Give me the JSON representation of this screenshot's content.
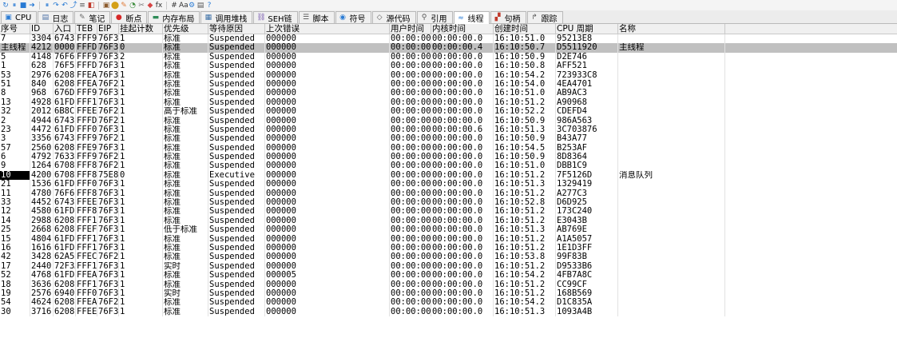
{
  "toolbar": {
    "icons": [
      "refresh-icon",
      "pause-icon",
      "stop-icon",
      "step-into-icon",
      "pause2-icon",
      "step-over-icon",
      "step-out-icon",
      "run-to-icon",
      "trace-icon",
      "animate-icon",
      "stack-icon",
      "memory-icon",
      "highlight-icon",
      "labels-icon",
      "comments-icon",
      "bookmark-icon",
      "function-icon",
      "hash-icon",
      "font-icon",
      "settings-icon",
      "layers-icon",
      "about-icon"
    ],
    "glyphs": [
      "↻",
      "⏸",
      "■",
      "➜",
      "⏸",
      "↷",
      "↶",
      "⤴",
      "≡",
      "◧",
      "▣",
      "⬤",
      "✎",
      "◔",
      "✂",
      "◆",
      "fx",
      "#",
      "Aa",
      "⚙",
      "▤",
      "?"
    ]
  },
  "tabs": [
    {
      "label": "CPU",
      "icon": "cpu-icon",
      "glyph": "▣",
      "active": false
    },
    {
      "label": "日志",
      "icon": "log-icon",
      "glyph": "▤",
      "active": false
    },
    {
      "label": "笔记",
      "icon": "notes-icon",
      "glyph": "✎",
      "active": false
    },
    {
      "label": "断点",
      "icon": "breakpoint-icon",
      "glyph": "●",
      "active": false
    },
    {
      "label": "内存布局",
      "icon": "memory-map-icon",
      "glyph": "▬",
      "active": false
    },
    {
      "label": "调用堆栈",
      "icon": "call-stack-icon",
      "glyph": "▦",
      "active": false
    },
    {
      "label": "SEH链",
      "icon": "seh-icon",
      "glyph": "⛓",
      "active": false
    },
    {
      "label": "脚本",
      "icon": "script-icon",
      "glyph": "☰",
      "active": false
    },
    {
      "label": "符号",
      "icon": "symbols-icon",
      "glyph": "◉",
      "active": false
    },
    {
      "label": "源代码",
      "icon": "source-icon",
      "glyph": "◇",
      "active": false
    },
    {
      "label": "引用",
      "icon": "references-icon",
      "glyph": "⚲",
      "active": false
    },
    {
      "label": "线程",
      "icon": "threads-icon",
      "glyph": "≈",
      "active": true
    },
    {
      "label": "句柄",
      "icon": "handles-icon",
      "glyph": "▞",
      "active": false
    },
    {
      "label": "跟踪",
      "icon": "trace-tab-icon",
      "glyph": "↱",
      "active": false
    }
  ],
  "columns": [
    "序号",
    "ID",
    "入口",
    "TEB",
    "EIP",
    "挂起计数",
    "优先级",
    "等待原因",
    "上次错误",
    "用户时间",
    "内核时间",
    "创建时间",
    "CPU 周期",
    "名称"
  ],
  "rows": [
    [
      "7",
      "3304",
      "67433:",
      "FFF93",
      "76F31",
      "1",
      "标准",
      "Suspended",
      "000000",
      "00:00:00.0",
      "00:00:00.0",
      "16:10:51.0",
      "95213E8",
      ""
    ],
    [
      "主线程",
      "4212",
      "000000",
      "FFFDD",
      "76F30:",
      "0",
      "标准",
      "Suspended",
      "000000",
      "00:00:00.4",
      "00:00:00.4",
      "16:10:50.7",
      "D5511920",
      "主线程"
    ],
    [
      "5",
      "4148",
      "76F604",
      "FFF99",
      "76F31",
      "2",
      "标准",
      "Suspended",
      "000000",
      "00:00:00.0",
      "00:00:00.0",
      "16:10:50.9",
      "D2E746",
      ""
    ],
    [
      "1",
      "628",
      "76F5F5",
      "FFFDA",
      "76F30:",
      "1",
      "标准",
      "Suspended",
      "000000",
      "00:00:00.0",
      "00:00:00.0",
      "16:10:50.8",
      "AFF521",
      ""
    ],
    [
      "53",
      "2976",
      "62089",
      "FFEA7",
      "76F30:",
      "1",
      "标准",
      "Suspended",
      "000000",
      "00:00:00.8",
      "00:00:00.0",
      "16:10:54.2",
      "723933C8",
      ""
    ],
    [
      "51",
      "840",
      "62089",
      "FFEAD",
      "76F2F",
      "1",
      "标准",
      "Suspended",
      "000000",
      "00:00:00.0",
      "00:00:00.0",
      "16:10:54.0",
      "4EA4701",
      ""
    ],
    [
      "8",
      "968",
      "676D6",
      "FFF90",
      "76F30:",
      "1",
      "标准",
      "Suspended",
      "000000",
      "00:00:00.0",
      "00:00:00.0",
      "16:10:51.0",
      "AB9AC3",
      ""
    ],
    [
      "13",
      "4928",
      "61FD2",
      "FFF1F",
      "76F30:",
      "1",
      "标准",
      "Suspended",
      "000000",
      "00:00:00.0",
      "00:00:00.0",
      "16:10:51.2",
      "A90968",
      ""
    ],
    [
      "32",
      "2012",
      "6B8C6",
      "FFEE3",
      "76F2F",
      "1",
      "高于标准",
      "Suspended",
      "000000",
      "00:00:00.0",
      "00:00:00.0",
      "16:10:52.2",
      "CDEFD4",
      ""
    ],
    [
      "2",
      "4944",
      "67433:",
      "FFFD7",
      "76F2F",
      "1",
      "标准",
      "Suspended",
      "000000",
      "00:00:00.0",
      "00:00:00.0",
      "16:10:50.9",
      "986A563",
      ""
    ],
    [
      "23",
      "4472",
      "61FD2",
      "FFF07",
      "76F30:",
      "1",
      "标准",
      "Suspended",
      "000000",
      "00:00:00.0",
      "00:00:00.6",
      "16:10:51.3",
      "3C703876",
      ""
    ],
    [
      "3",
      "3356",
      "67433:",
      "FFF9F",
      "76F2F",
      "1",
      "标准",
      "Suspended",
      "000000",
      "00:00:00.0",
      "00:00:00.0",
      "16:10:50.9",
      "B43A77",
      ""
    ],
    [
      "57",
      "2560",
      "62089",
      "FFE98",
      "76F30:",
      "1",
      "标准",
      "Suspended",
      "000000",
      "00:00:00.0",
      "00:00:00.0",
      "16:10:54.5",
      "B253AF",
      ""
    ],
    [
      "6",
      "4792",
      "7633D",
      "FFF96",
      "76F2F",
      "1",
      "标准",
      "Suspended",
      "000000",
      "00:00:00.0",
      "00:00:00.0",
      "16:10:50.9",
      "8D8364",
      ""
    ],
    [
      "9",
      "1264",
      "6708D",
      "FFF8D",
      "76F2F",
      "1",
      "标准",
      "Suspended",
      "000000",
      "00:00:00.0",
      "00:00:00.0",
      "16:10:51.0",
      "DBB1C9",
      ""
    ],
    [
      "10",
      "4200",
      "6708D",
      "FFF8A",
      "75E81",
      "0",
      "标准",
      "Executive",
      "000000",
      "00:00:00.0",
      "00:00:00.0",
      "16:10:51.2",
      "7F5126D",
      "消息队列"
    ],
    [
      "21",
      "1536",
      "61FD2",
      "FFF0D",
      "76F30:",
      "1",
      "标准",
      "Suspended",
      "000000",
      "00:00:00.0",
      "00:00:00.0",
      "16:10:51.3",
      "1329419",
      ""
    ],
    [
      "11",
      "4780",
      "76F604",
      "FFF87",
      "76F31",
      "1",
      "标准",
      "Suspended",
      "000000",
      "00:00:00.0",
      "00:00:00.0",
      "16:10:51.2",
      "A277C3",
      ""
    ],
    [
      "33",
      "4452",
      "67433:",
      "FFEE0",
      "76F31",
      "1",
      "标准",
      "Suspended",
      "000000",
      "00:00:00.0",
      "00:00:00.0",
      "16:10:52.8",
      "D6D925",
      ""
    ],
    [
      "12",
      "4580",
      "61FD2",
      "FFF84",
      "76F30:",
      "1",
      "标准",
      "Suspended",
      "000000",
      "00:00:00.0",
      "00:00:00.0",
      "16:10:51.2",
      "173C240",
      ""
    ],
    [
      "14",
      "2988",
      "62089",
      "FFF1C",
      "76F30:",
      "1",
      "标准",
      "Suspended",
      "000000",
      "00:00:00.0",
      "00:00:00.0",
      "16:10:51.2",
      "E3043B",
      ""
    ],
    [
      "25",
      "2668",
      "62089",
      "FFEFE",
      "76F30:",
      "1",
      "低于标准",
      "Suspended",
      "000000",
      "00:00:00.0",
      "00:00:00.0",
      "16:10:51.3",
      "AB769E",
      ""
    ],
    [
      "15",
      "4804",
      "61FD2",
      "FFF19",
      "76F30:",
      "1",
      "标准",
      "Suspended",
      "000000",
      "00:00:00.0",
      "00:00:00.0",
      "16:10:51.2",
      "A1A5057",
      ""
    ],
    [
      "16",
      "1616",
      "61FD2",
      "FFF16",
      "76F30:",
      "1",
      "标准",
      "Suspended",
      "000000",
      "00:00:00.0",
      "00:00:00.0",
      "16:10:51.2",
      "1E1D3FF",
      ""
    ],
    [
      "42",
      "3428",
      "62A5D",
      "FFEC8",
      "76F2F",
      "1",
      "标准",
      "Suspended",
      "000000",
      "00:00:00.0",
      "00:00:00.0",
      "16:10:53.8",
      "99F83B",
      ""
    ],
    [
      "17",
      "2440",
      "72F3A",
      "FFF13",
      "76F30:",
      "1",
      "实时",
      "Suspended",
      "000000",
      "00:00:00.0",
      "00:00:00.0",
      "16:10:51.2",
      "D9533B6",
      ""
    ],
    [
      "52",
      "4768",
      "61FD2",
      "FFEAA",
      "76F30:",
      "1",
      "标准",
      "Suspended",
      "000005",
      "00:00:00.0",
      "00:00:00.0",
      "16:10:54.2",
      "4FB7A8C",
      ""
    ],
    [
      "18",
      "3636",
      "62089",
      "FFF10",
      "76F30:",
      "1",
      "标准",
      "Suspended",
      "000000",
      "00:00:00.0",
      "00:00:00.0",
      "16:10:51.2",
      "CC99CF",
      ""
    ],
    [
      "19",
      "2576",
      "6940E",
      "FFF04",
      "76F30:",
      "1",
      "实时",
      "Suspended",
      "000000",
      "00:00:00.0",
      "00:00:00.0",
      "16:10:51.2",
      "168B569",
      ""
    ],
    [
      "54",
      "4624",
      "62089",
      "FFEA4",
      "76F2F",
      "1",
      "标准",
      "Suspended",
      "000000",
      "00:00:00.0",
      "00:00:00.0",
      "16:10:54.2",
      "D1C835A",
      ""
    ],
    [
      "30",
      "3716",
      "62089",
      "FFEEC",
      "76F30:",
      "1",
      "标准",
      "Suspended",
      "000000",
      "00:00:00.0",
      "00:00:00.0",
      "16:10:51.3",
      "1093A4B",
      ""
    ]
  ],
  "selected_row": 1,
  "current_thread_row": 15
}
